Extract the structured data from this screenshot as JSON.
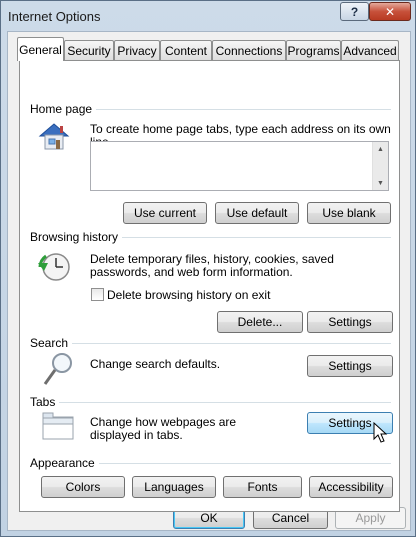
{
  "window": {
    "title": "Internet Options",
    "help_glyph": "?",
    "close_glyph": "✕"
  },
  "tabs": [
    {
      "label": "General"
    },
    {
      "label": "Security"
    },
    {
      "label": "Privacy"
    },
    {
      "label": "Content"
    },
    {
      "label": "Connections"
    },
    {
      "label": "Programs"
    },
    {
      "label": "Advanced"
    }
  ],
  "home_page": {
    "heading": "Home page",
    "description": "To create home page tabs, type each address on its own line.",
    "buttons": {
      "use_current": "Use current",
      "use_default": "Use default",
      "use_blank": "Use blank"
    }
  },
  "browsing_history": {
    "heading": "Browsing history",
    "description": "Delete temporary files, history, cookies, saved passwords, and web form information.",
    "checkbox_label": "Delete browsing history on exit",
    "checkbox_checked": false,
    "buttons": {
      "delete": "Delete...",
      "settings": "Settings"
    }
  },
  "search": {
    "heading": "Search",
    "description": "Change search defaults.",
    "settings_label": "Settings"
  },
  "tabs_section": {
    "heading": "Tabs",
    "description": "Change how webpages are displayed in tabs.",
    "settings_label": "Settings"
  },
  "appearance": {
    "heading": "Appearance",
    "buttons": {
      "colors": "Colors",
      "languages": "Languages",
      "fonts": "Fonts",
      "accessibility": "Accessibility"
    }
  },
  "footer": {
    "ok": "OK",
    "cancel": "Cancel",
    "apply": "Apply"
  }
}
